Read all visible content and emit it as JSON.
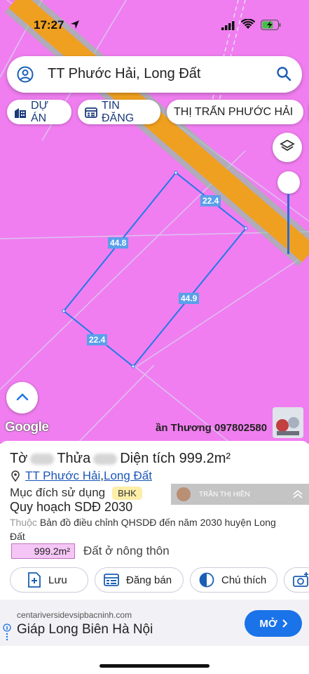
{
  "status": {
    "time": "17:27"
  },
  "search": {
    "query": "TT Phước Hải, Long Đất"
  },
  "chips": [
    {
      "label": "DỰ ÁN"
    },
    {
      "label": "TIN ĐĂNG"
    },
    {
      "label": "THỊ TRẤN PHƯỚC HẢI"
    }
  ],
  "map": {
    "edges": [
      "22.4",
      "44.8",
      "44.9",
      "22.4"
    ],
    "google": "Google",
    "watermark": "ần Thương 097802580"
  },
  "parcel": {
    "sheet_label": "Tờ",
    "plot_label": "Thửa",
    "area_label": "Diện tích 999.2m²",
    "location_a": "TT Phước Hải",
    "location_sep": ", ",
    "location_b": "Long Đất",
    "purpose_label": "Mục đích sử dụng",
    "purpose_badge": "BHK",
    "plan_title": "Quy hoạch SDĐ 2030",
    "belong_label": "Thuộc",
    "belong_text": "Bản đồ điều chỉnh QHSDĐ đến năm 2030 huyện Long Đất",
    "area_value": "999.2m²",
    "area_type": "Đất ở nông thôn",
    "banner_name": "TRẦN THỊ HIỀN"
  },
  "actions": {
    "save": "Lưu",
    "sell": "Đăng bán",
    "note": "Chú thích"
  },
  "ad": {
    "url": "centariversidevsipbacninh.com",
    "title": "Giáp Long Biên Hà Nội",
    "button": "MỞ"
  },
  "colors": {
    "map_fill": "#f07ef0",
    "road": "#f0a020",
    "parcel_line": "#1e7ae8",
    "accent": "#1a73e8"
  }
}
